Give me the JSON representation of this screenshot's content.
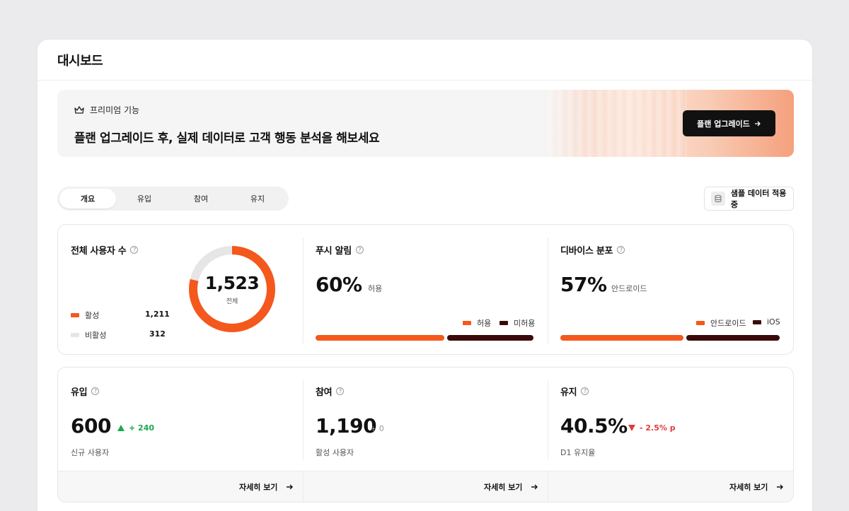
{
  "header": {
    "title": "대시보드"
  },
  "banner": {
    "tag": "프리미엄 기능",
    "headline": "플랜 업그레이드 후, 실제 데이터로 고객 행동 분석을 해보세요",
    "button": "플랜 업그레이드"
  },
  "tabs": [
    "개요",
    "유입",
    "참여",
    "유지"
  ],
  "sample_badge": "샘플 데이터 적용중",
  "users": {
    "title": "전체 사용자 수",
    "total": "1,523",
    "total_label": "전체",
    "legend": [
      {
        "label": "활성",
        "value": "1,211",
        "color": "#f4581c"
      },
      {
        "label": "비활성",
        "value": "312",
        "color": "#e5e5e5"
      }
    ]
  },
  "push": {
    "title": "푸시 알림",
    "value": "60%",
    "value_label": "허용",
    "legend": [
      {
        "label": "허용",
        "color": "#f4581c"
      },
      {
        "label": "미허용",
        "color": "#3a0a0a"
      }
    ],
    "allowed_ratio": 0.6
  },
  "device": {
    "title": "디바이스 분포",
    "value": "57%",
    "value_label": "안드로이드",
    "legend": [
      {
        "label": "안드로이드",
        "color": "#f4581c"
      },
      {
        "label": "iOS",
        "color": "#3a0a0a"
      }
    ],
    "android_ratio": 0.57
  },
  "acquisition": {
    "title": "유입",
    "value": "600",
    "delta": "+ 240",
    "delta_color": "#19a84a",
    "sub": "신규 사용자",
    "link": "자세히 보기"
  },
  "engagement": {
    "title": "참여",
    "value": "1,190",
    "delta": "+ 0",
    "sub": "활성 사용자",
    "link": "자세히 보기"
  },
  "retention": {
    "title": "유지",
    "value": "40.5%",
    "delta": "- 2.5% p",
    "delta_color": "#e23b3b",
    "sub": "D1 유지율",
    "link": "자세히 보기"
  }
}
